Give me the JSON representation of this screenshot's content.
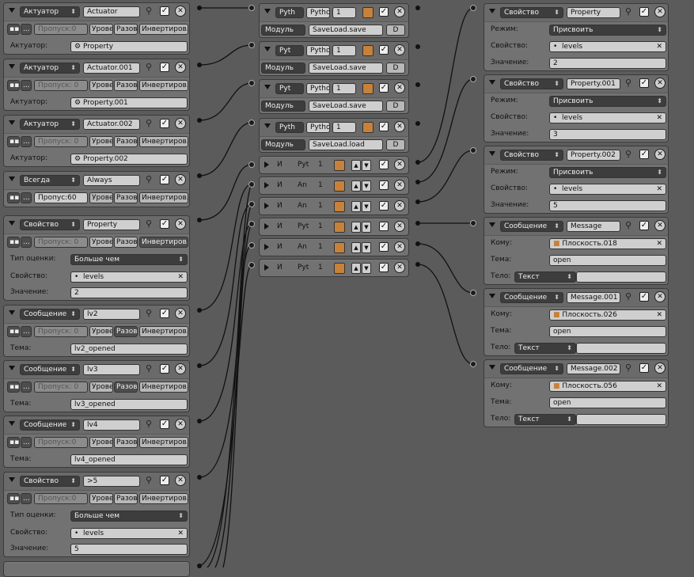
{
  "labels": {
    "aktuator": "Актуатор:",
    "tema": "Тема:",
    "tip": "Тип оценки:",
    "svoistvo": "Свойство:",
    "znachenie": "Значение:",
    "rezhim": "Режим:",
    "komu": "Кому:",
    "telo": "Тело:",
    "modul": "Модуль",
    "d": "D",
    "i": "И",
    "urov": "Урове",
    "razov": "Разово",
    "invert": "Инвертиров..",
    "dots": "...",
    "dots2": "..."
  },
  "sensors": [
    {
      "type": "Актуатор",
      "name": "Actuator",
      "skip": "Пропуск:0",
      "actuator": "Property"
    },
    {
      "type": "Актуатор",
      "name": "Actuator.001",
      "skip": "Пропуск: 0",
      "actuator": "Property.001"
    },
    {
      "type": "Актуатор",
      "name": "Actuator.002",
      "skip": "Пропуск: 0",
      "actuator": "Property.002"
    },
    {
      "type": "Всегда",
      "name": "Always",
      "skip": "Пропус:60"
    },
    {
      "type": "Свойство",
      "name": "Property",
      "skip": "Пропуск: 0",
      "eval": "Больше чем",
      "prop": "levels",
      "value": "2"
    },
    {
      "type": "Сообщение",
      "name": "lv2",
      "skip": "Пропуск: 0",
      "subject": "lv2_opened"
    },
    {
      "type": "Сообщение",
      "name": "lv3",
      "skip": "Пропуск: 0",
      "subject": "lv3_opened"
    },
    {
      "type": "Сообщение",
      "name": "lv4",
      "skip": "Пропуск:0",
      "subject": "lv4_opened"
    },
    {
      "type": "Свойство",
      "name": ">5",
      "skip": "Пропуск:0",
      "eval": "Больше чем",
      "prop": "levels",
      "value": "5"
    }
  ],
  "controllers_python": [
    {
      "type": "Pyth",
      "script": "Pytho",
      "num": "1",
      "module": "SaveLoad.save"
    },
    {
      "type": "Pyt",
      "script": "Pytho",
      "num": "1",
      "module": "SaveLoad.save"
    },
    {
      "type": "Pyt",
      "script": "Pytho",
      "num": "1",
      "module": "SaveLoad.save"
    },
    {
      "type": "Pyth",
      "script": "Pytho",
      "num": "1",
      "module": "SaveLoad.load"
    }
  ],
  "controllers_and": [
    {
      "name": "Pyt",
      "num": "1"
    },
    {
      "name": "An",
      "num": "1"
    },
    {
      "name": "An",
      "num": "1"
    },
    {
      "name": "Pyt",
      "num": "1"
    },
    {
      "name": "An",
      "num": "1"
    },
    {
      "name": "Pyt",
      "num": "1"
    }
  ],
  "actuators": [
    {
      "type": "Свойство",
      "name": "Property",
      "mode": "Присвоить",
      "prop": "levels",
      "value": "2"
    },
    {
      "type": "Свойство",
      "name": "Property.001",
      "mode": "Присвоить",
      "prop": "levels",
      "value": "3"
    },
    {
      "type": "Свойство",
      "name": "Property.002",
      "mode": "Присвоить",
      "prop": "levels",
      "value": "5"
    },
    {
      "type": "Сообщение",
      "name": "Message",
      "to": "Плоскость.018",
      "subject": "open",
      "body": "Текст"
    },
    {
      "type": "Сообщение",
      "name": "Message.001",
      "to": "Плоскость.026",
      "subject": "open",
      "body": "Текст"
    },
    {
      "type": "Сообщение",
      "name": "Message.002",
      "to": "Плоскость.056",
      "subject": "open",
      "body": "Текст"
    }
  ],
  "colors": {
    "bg": "#5b5b5b",
    "panel": "#727272",
    "wire": "#111111"
  }
}
